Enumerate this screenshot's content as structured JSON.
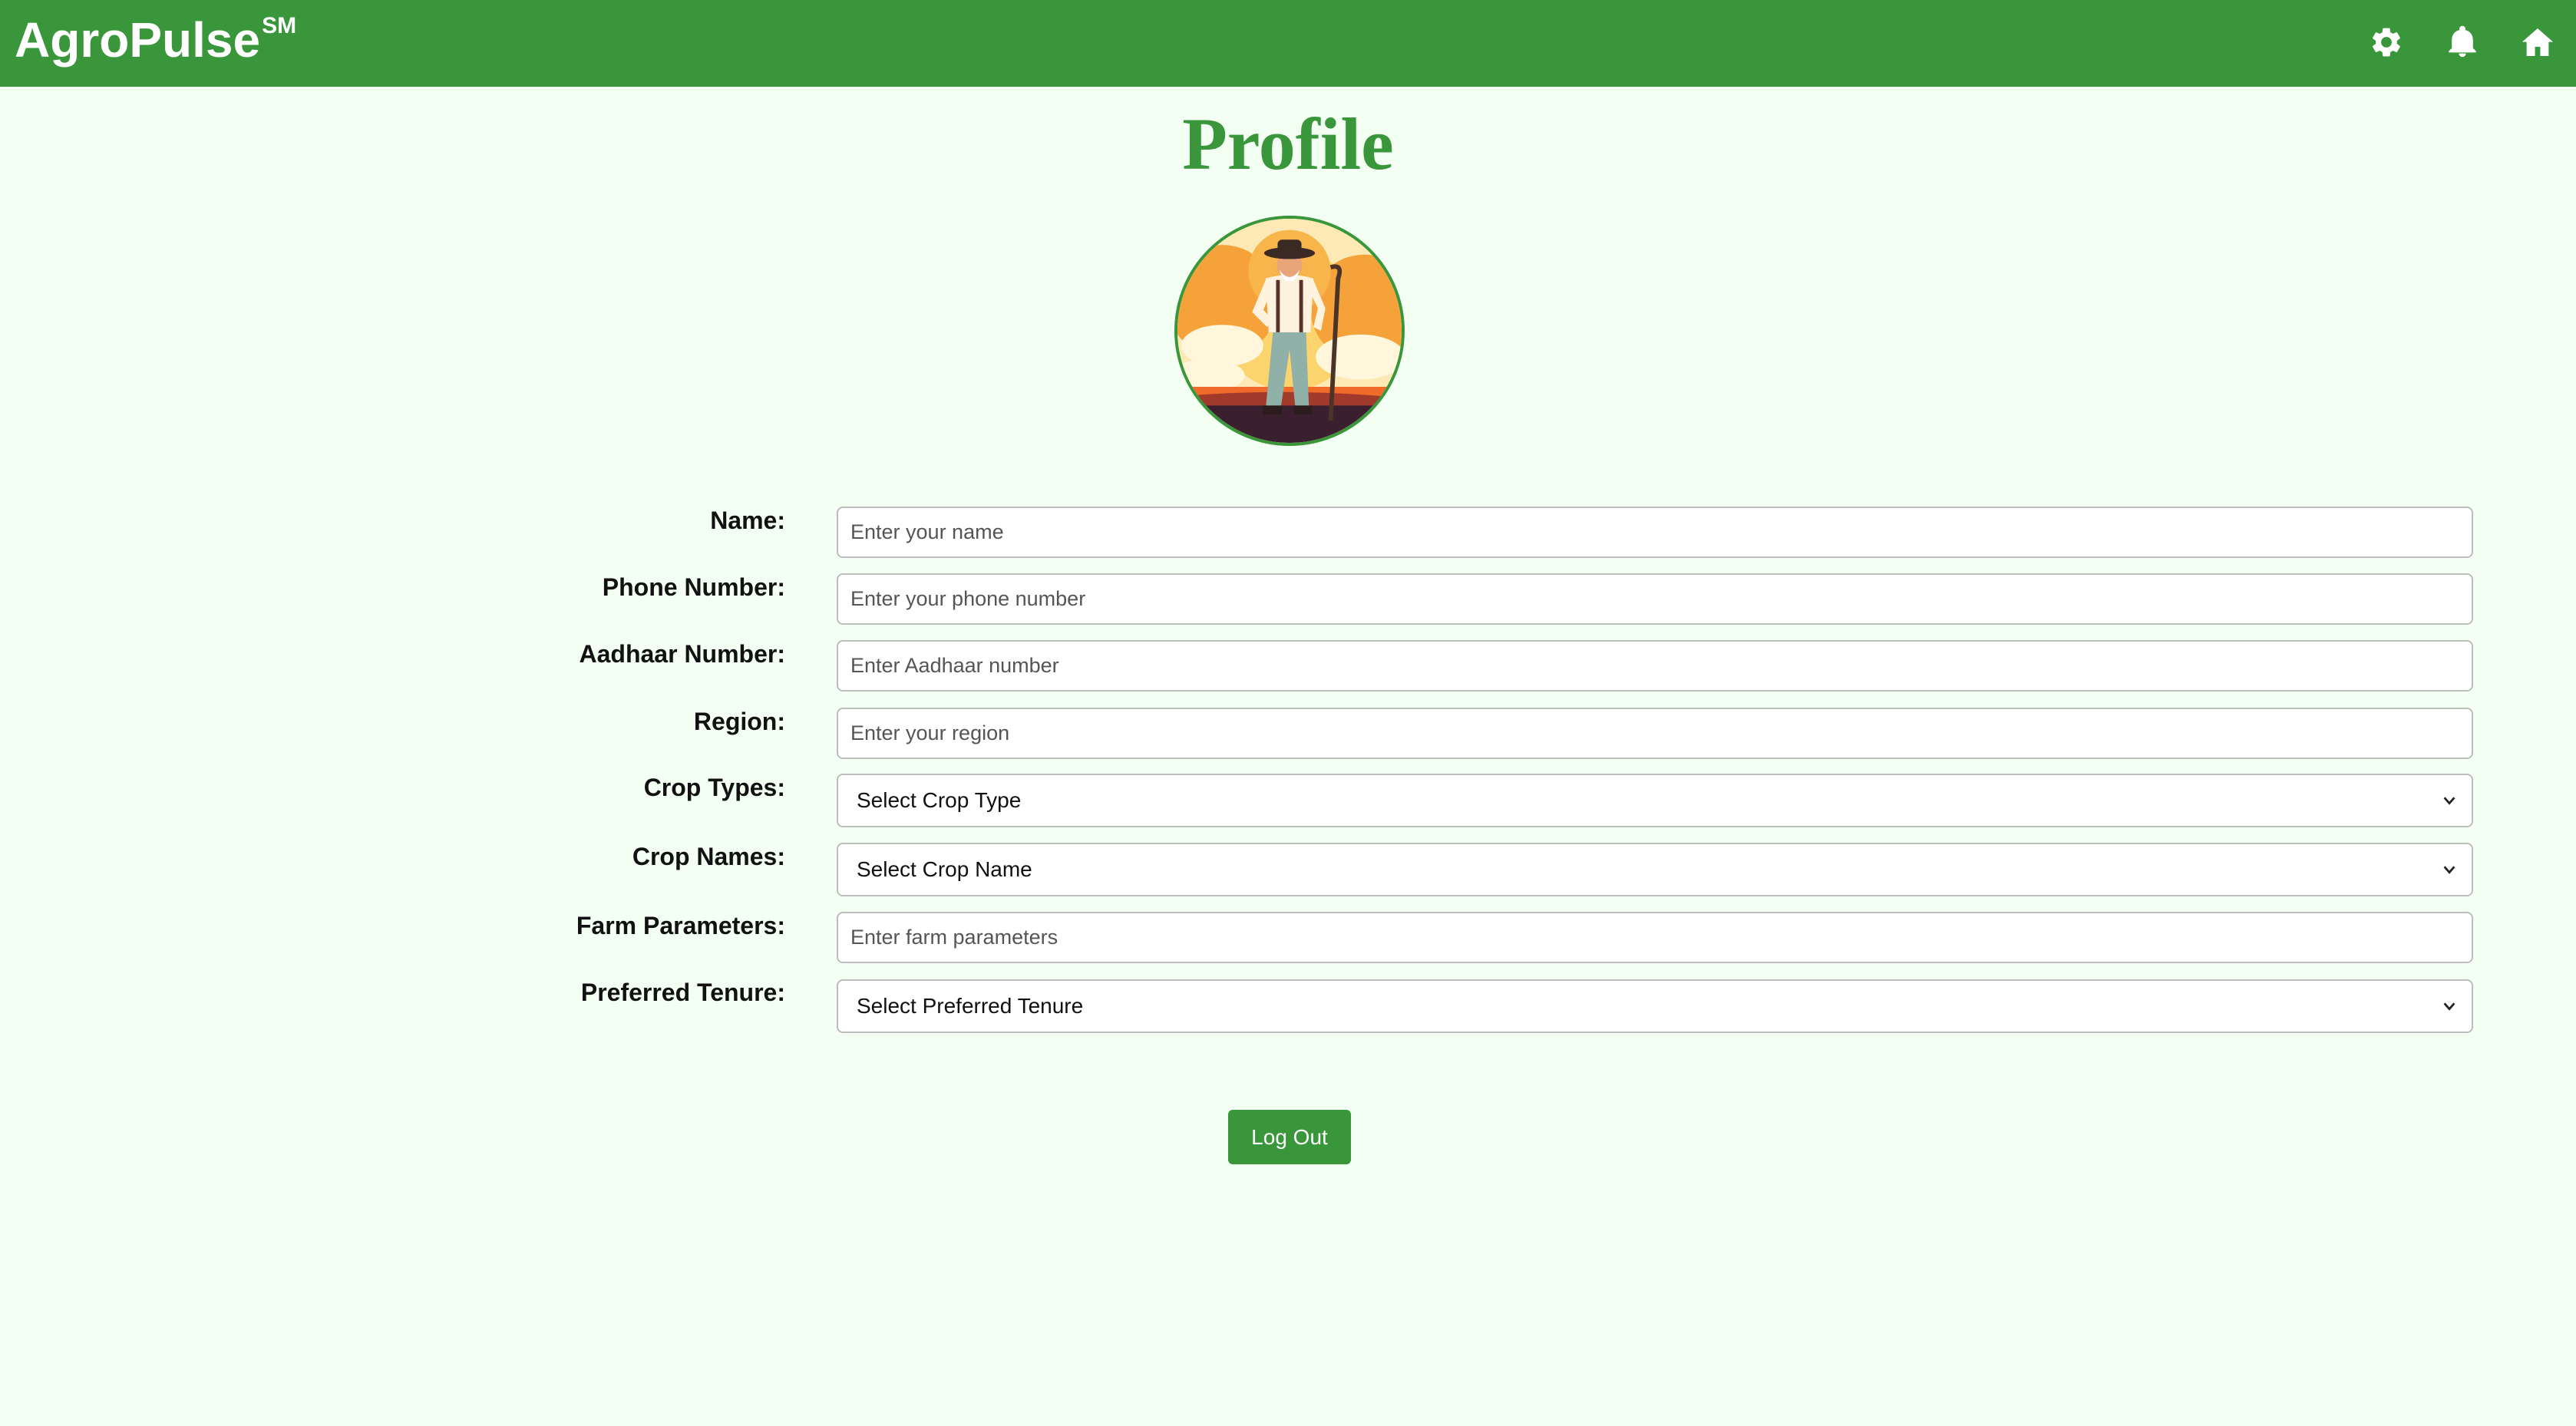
{
  "header": {
    "brand": "AgroPulse",
    "brand_mark": "SM",
    "icons": [
      "gear-icon",
      "bell-icon",
      "home-icon"
    ],
    "background_color": "#39963a"
  },
  "page": {
    "title": "Profile",
    "accent_color": "#39963a",
    "background_color": "#f3fff3"
  },
  "form": {
    "name_label": "Name:",
    "name_placeholder": "Enter your name",
    "phone_label": "Phone Number:",
    "phone_placeholder": "Enter your phone number",
    "aadhaar_label": "Aadhaar Number:",
    "aadhaar_placeholder": "Enter Aadhaar number",
    "region_label": "Region:",
    "region_placeholder": "Enter your region",
    "crop_types_label": "Crop Types:",
    "crop_types_value": "Select Crop Type",
    "crop_names_label": "Crop Names:",
    "crop_names_value": "Select Crop Name",
    "farm_params_label": "Farm Parameters:",
    "farm_params_placeholder": "Enter farm parameters",
    "tenure_label": "Preferred Tenure:",
    "tenure_value": "Select Preferred Tenure"
  },
  "actions": {
    "logout_label": "Log Out"
  }
}
